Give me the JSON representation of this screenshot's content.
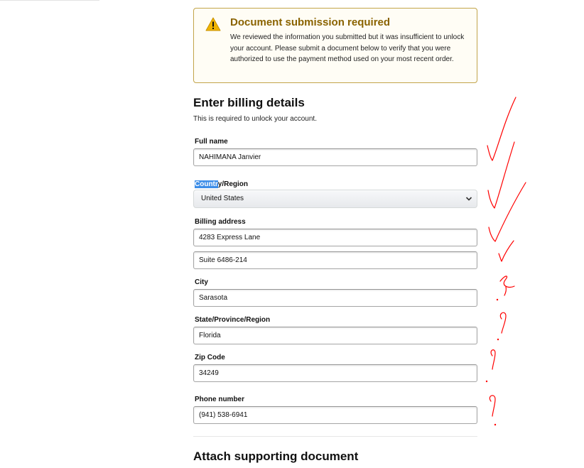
{
  "alert": {
    "icon": "warning-icon",
    "title": "Document submission required",
    "body": "We reviewed the information you submitted but it was insufficient to unlock your account. Please submit a document below to verify that you were authorized to use the payment method used on your most recent order.",
    "accent_color": "#c2a44a",
    "title_color": "#8a6300"
  },
  "billing": {
    "heading": "Enter billing details",
    "subtext": "This is required to unlock your account.",
    "full_name": {
      "label": "Full name",
      "value": "NAHIMANA Janvier"
    },
    "country": {
      "label_highlighted": "Countr",
      "label_rest": "y/Region",
      "selected": "United States",
      "icon": "chevron-down-icon"
    },
    "billing_address": {
      "label": "Billing address",
      "line1": "4283 Express Lane",
      "line2": "Suite 6486-214"
    },
    "city": {
      "label": "City",
      "value": "Sarasota"
    },
    "state": {
      "label": "State/Province/Region",
      "value": "Florida"
    },
    "zip": {
      "label": "Zip Code",
      "value": "34249"
    },
    "phone": {
      "label": "Phone number",
      "value": "(941) 538-6941"
    }
  },
  "attach": {
    "heading": "Attach supporting document"
  },
  "annotation_color": "#ff0000"
}
